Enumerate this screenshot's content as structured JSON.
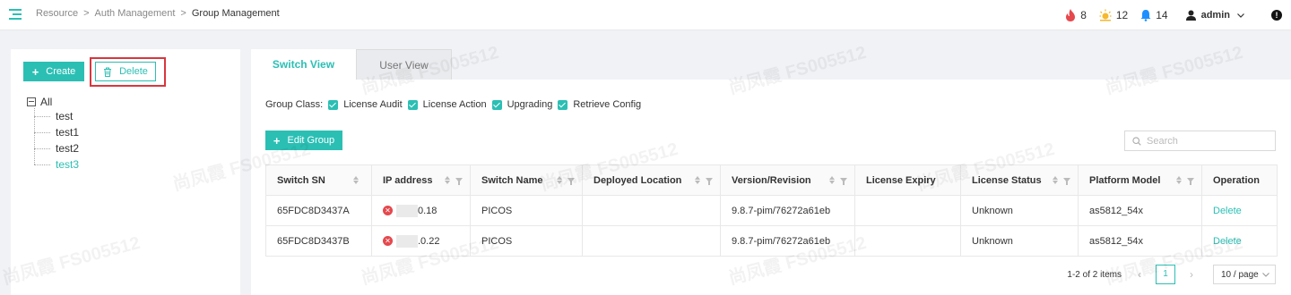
{
  "breadcrumb": [
    "Resource",
    "Auth Management",
    "Group Management"
  ],
  "alerts": {
    "critical": "8",
    "warning": "12",
    "notice": "14"
  },
  "user": {
    "name": "admin"
  },
  "left_panel": {
    "create_label": "Create",
    "delete_label": "Delete",
    "tree": {
      "root": "All",
      "children": [
        "test",
        "test1",
        "test2",
        "test3"
      ],
      "selected": "test3"
    }
  },
  "tabs": [
    "Switch View",
    "User View"
  ],
  "active_tab": "Switch View",
  "group_class": {
    "label": "Group Class:",
    "options": [
      "License Audit",
      "License Action",
      "Upgrading",
      "Retrieve Config"
    ]
  },
  "edit_group_label": "Edit Group",
  "search": {
    "placeholder": "Search",
    "value": ""
  },
  "table": {
    "columns": [
      "Switch SN",
      "IP address",
      "Switch Name",
      "Deployed Location",
      "Version/Revision",
      "License Expiry",
      "License Status",
      "Platform Model",
      "Operation"
    ],
    "rows": [
      {
        "sn": "65FDC8D3437A",
        "ip": "0.18",
        "name": "PICOS",
        "location": "",
        "version": "9.8.7-pim/76272a61eb",
        "expiry": "",
        "status": "Unknown",
        "model": "as5812_54x",
        "operation": "Delete"
      },
      {
        "sn": "65FDC8D3437B",
        "ip": ".0.22",
        "name": "PICOS",
        "location": "",
        "version": "9.8.7-pim/76272a61eb",
        "expiry": "",
        "status": "Unknown",
        "model": "as5812_54x",
        "operation": "Delete"
      }
    ]
  },
  "pagination": {
    "total_text": "1-2 of 2 items",
    "current_page": "1",
    "page_size": "10 / page"
  },
  "watermark": "尚凤霞 FS005512",
  "colors": {
    "accent": "#2bbfb4",
    "error": "#e5484d",
    "highlight": "#d9363e"
  }
}
